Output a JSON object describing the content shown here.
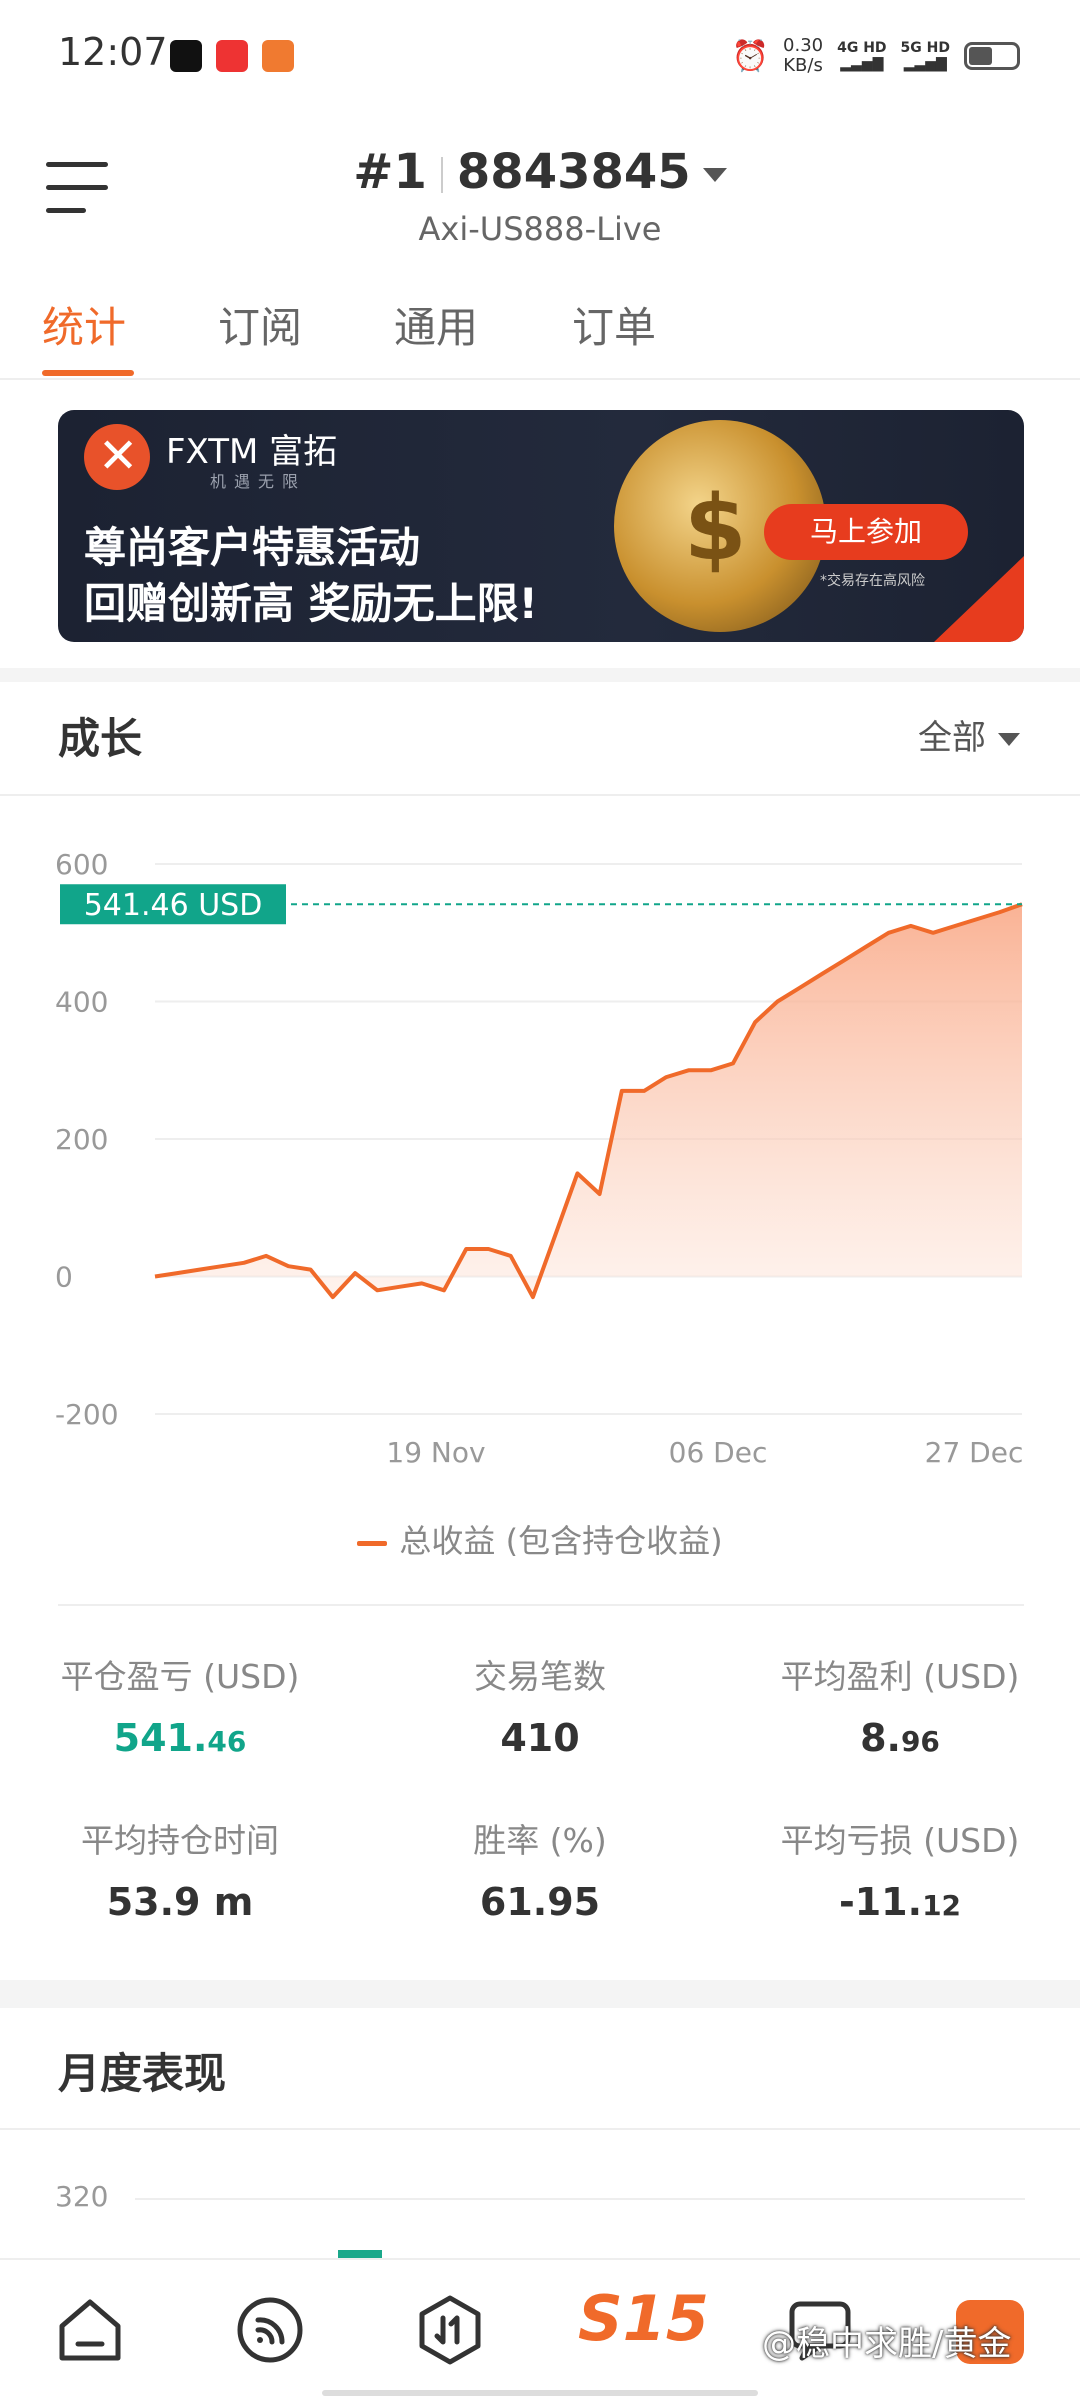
{
  "status_bar": {
    "time": "12:07",
    "speed_value": "0.30",
    "speed_unit": "KB/s",
    "net1": "4G HD",
    "net2": "5G HD",
    "app_icons": [
      "video-app-icon",
      "toutiao-app-icon",
      "orange-app-icon"
    ]
  },
  "header": {
    "rank": "#1",
    "account_number": "8843845",
    "server": "Axi-US888-Live"
  },
  "tabs": [
    {
      "label": "统计",
      "active": true
    },
    {
      "label": "订阅",
      "active": false
    },
    {
      "label": "通用",
      "active": false
    },
    {
      "label": "订单",
      "active": false
    }
  ],
  "banner": {
    "brand": "FXTM 富拓",
    "slogan": "机遇无限",
    "line1": "尊尚客户特惠活动",
    "line2": "回赠创新高 奖励无上限!",
    "button": "马上参加",
    "risk_note": "*交易存在高风险"
  },
  "growth": {
    "title": "成长",
    "filter": "全部"
  },
  "chart_data": {
    "type": "area",
    "current_label": "541.46 USD",
    "current_value": 541.46,
    "ylim": [
      -200,
      600
    ],
    "yticks": [
      600,
      400,
      200,
      0,
      -200
    ],
    "xtick_labels": [
      "19 Nov",
      "06 Dec",
      "27 Dec"
    ],
    "legend": "总收益 (包含持仓收益)",
    "series": [
      {
        "name": "总收益 (包含持仓收益)",
        "values": [
          0,
          5,
          10,
          15,
          20,
          30,
          15,
          10,
          -30,
          5,
          -20,
          -15,
          -10,
          -20,
          40,
          40,
          30,
          -30,
          60,
          150,
          120,
          270,
          270,
          290,
          300,
          300,
          310,
          370,
          400,
          420,
          440,
          460,
          480,
          500,
          510,
          500,
          510,
          520,
          530,
          541.46
        ]
      }
    ],
    "colors": {
      "line": "#f06a2a",
      "fill_top": "#f9a582",
      "label_bg": "#11a58a"
    }
  },
  "stats": [
    {
      "label": "平仓盈亏 (USD)",
      "value_main": "541.",
      "value_dec": "46",
      "green": true
    },
    {
      "label": "交易笔数",
      "value_main": "410",
      "value_dec": "",
      "green": false
    },
    {
      "label": "平均盈利 (USD)",
      "value_main": "8.",
      "value_dec": "96",
      "green": false
    },
    {
      "label": "平均持仓时间",
      "value_main": "53.9 m",
      "value_dec": "",
      "green": false
    },
    {
      "label": "胜率 (%)",
      "value_main": "61.95",
      "value_dec": "",
      "green": false
    },
    {
      "label": "平均亏损 (USD)",
      "value_main": "-11.",
      "value_dec": "12",
      "green": false
    }
  ],
  "monthly": {
    "title": "月度表现",
    "tick": "320"
  },
  "bottom_nav": {
    "brand": "S15",
    "watermark": "@稳中求胜/黄金"
  }
}
